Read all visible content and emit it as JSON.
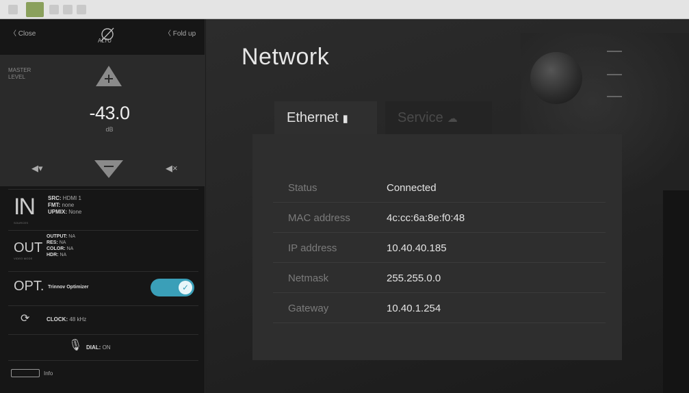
{
  "sidebar": {
    "close_label": "〈 Close",
    "fold_label": "〈 Fold up",
    "master_label": "MASTER LEVEL",
    "volume_value": "-43.0",
    "volume_unit": "dB",
    "in": {
      "label": "IN",
      "sub": "SOURCES",
      "src_key": "SRC:",
      "src_val": "HDMI 1",
      "fmt_key": "FMT:",
      "fmt_val": "none",
      "upmix_key": "UPMIX:",
      "upmix_val": "None"
    },
    "out": {
      "label": "OUT",
      "sub": "VIDEO MODE",
      "output_key": "OUTPUT:",
      "output_val": "NA",
      "res_key": "RES:",
      "res_val": "NA",
      "color_key": "COLOR:",
      "color_val": "NA",
      "hdr_key": "HDR:",
      "hdr_val": "NA"
    },
    "opt": {
      "label": "OPT.",
      "name": "Trinnov Optimizer",
      "enabled": true
    },
    "clock": {
      "key": "CLOCK:",
      "value": "48 kHz"
    },
    "dial": {
      "key": "DIAL:",
      "value": "ON"
    },
    "info_label": "Info"
  },
  "main": {
    "title": "Network",
    "tabs": [
      {
        "label": "Ethernet",
        "icon": "plug-icon",
        "active": true
      },
      {
        "label": "Service",
        "icon": "cloud-icon",
        "active": false
      }
    ],
    "rows": [
      {
        "key": "Status",
        "value": "Connected"
      },
      {
        "key": "MAC address",
        "value": "4c:cc:6a:8e:f0:48"
      },
      {
        "key": "IP address",
        "value": "10.40.40.185"
      },
      {
        "key": "Netmask",
        "value": "255.255.0.0"
      },
      {
        "key": "Gateway",
        "value": "10.40.1.254"
      }
    ]
  },
  "colors": {
    "accent": "#3a9fb8",
    "sidebar_bg": "#161616",
    "panel_bg": "#2e2e2e"
  }
}
